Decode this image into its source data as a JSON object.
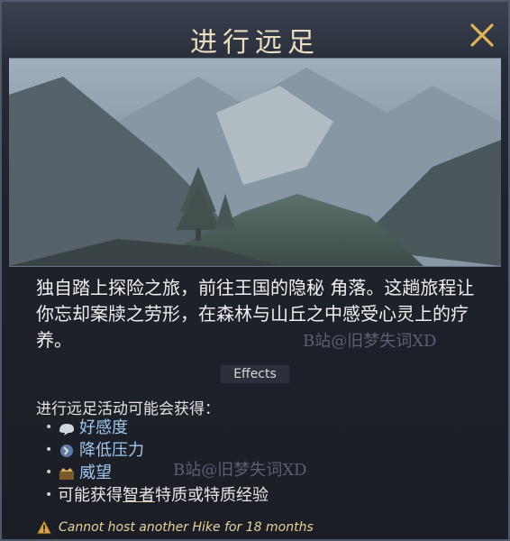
{
  "window": {
    "title": "进行远足",
    "close_icon": "close-icon"
  },
  "description": "独自踏上探险之旅，前往王国的隐秘 角落。这趟旅程让你忘却案牍之劳形，在森林与山丘之中感受心灵上的疗养。",
  "watermark": "B站@旧梦失词XD",
  "effects": {
    "header": "Effects",
    "intro": "进行远足活动可能会获得：",
    "items": [
      {
        "icon": "opinion-icon",
        "label": "好感度"
      },
      {
        "icon": "stress-icon",
        "label": "降低压力"
      },
      {
        "icon": "prestige-icon",
        "label": "威望"
      }
    ],
    "trait_prefix": "可能获得",
    "trait_name": "智者",
    "trait_suffix": "特质或特质经验"
  },
  "warning": {
    "icon": "warning-icon",
    "text": "Cannot host another Hike for 18 months"
  },
  "colors": {
    "title": "#e9dcc0",
    "accent_close": "#e0b35a",
    "link_blue": "#9fc7ee",
    "warning": "#e7d29a"
  }
}
